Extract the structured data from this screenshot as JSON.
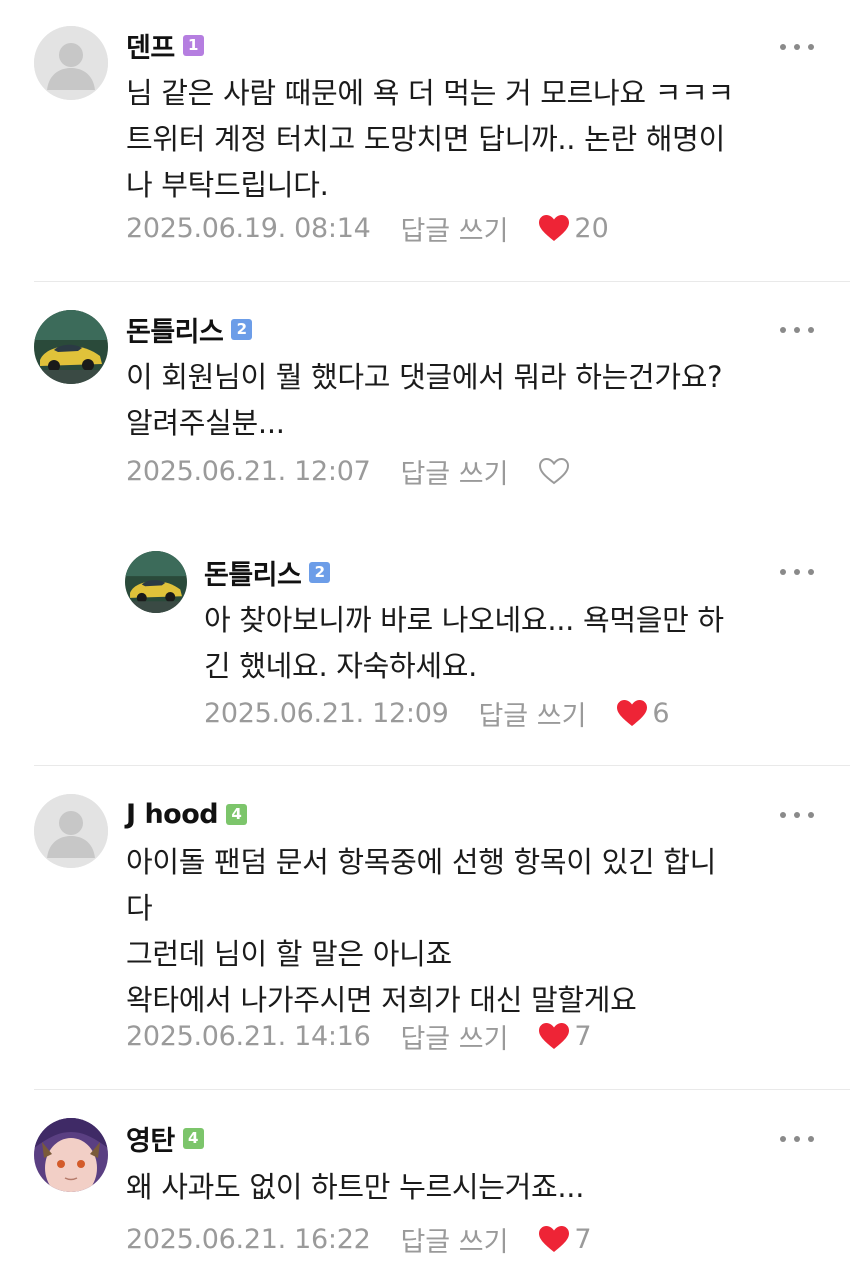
{
  "colors": {
    "heart": "#ee2436",
    "meta_text": "#9a9a9a",
    "level_1": "#b57ee0",
    "level_2": "#6c9de8",
    "level_4": "#7cc56b"
  },
  "comments": [
    {
      "author": "덴프",
      "level": "1",
      "avatar": "default-user",
      "text": "님 같은 사람 때문에 욕 더 먹는 거 모르나요 ㅋㅋㅋ\n트위터 계정 터치고 도망치면 답니까.. 논란 해명이\n나 부탁드립니다.",
      "date": "2025.06.19. 08:14",
      "reply_label": "답글 쓰기",
      "likes": "20",
      "liked": true
    },
    {
      "author": "돈틀리스",
      "level": "2",
      "avatar": "yellow-car",
      "text": "이 회원님이 뭘 했다고 댓글에서 뭐라 하는건가요?\n알려주실분...",
      "date": "2025.06.21. 12:07",
      "reply_label": "답글 쓰기",
      "likes": "",
      "liked": false
    },
    {
      "author": "돈틀리스",
      "level": "2",
      "avatar": "yellow-car",
      "text": "아 찾아보니까 바로 나오네요... 욕먹을만 하\n긴 했네요. 자숙하세요.",
      "date": "2025.06.21. 12:09",
      "reply_label": "답글 쓰기",
      "likes": "6",
      "liked": true
    },
    {
      "author": "J hood",
      "level": "4",
      "avatar": "default-user",
      "text": "아이돌 팬덤 문서 항목중에 선행 항목이 있긴 합니\n다\n그런데 님이 할 말은 아니죠\n왁타에서 나가주시면 저희가 대신 말할게요",
      "date": "2025.06.21. 14:16",
      "reply_label": "답글 쓰기",
      "likes": "7",
      "liked": true
    },
    {
      "author": "영탄",
      "level": "4",
      "avatar": "anime-character",
      "text": "왜 사과도 없이 하트만 누르시는거죠...",
      "date": "2025.06.21. 16:22",
      "reply_label": "답글 쓰기",
      "likes": "7",
      "liked": true
    }
  ]
}
